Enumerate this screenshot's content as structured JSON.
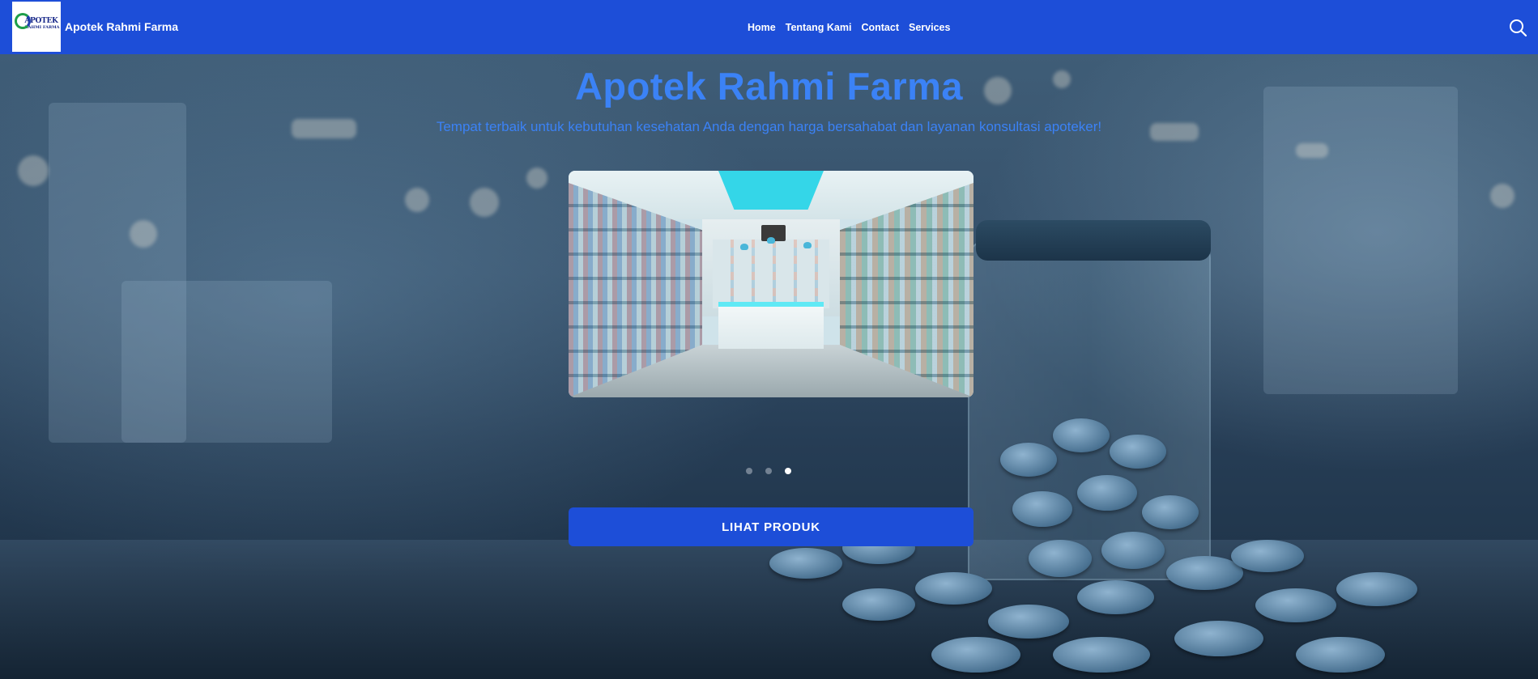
{
  "brand": {
    "name": "Apotek Rahmi Farma",
    "logo_line1": "APOTEK",
    "logo_line2": "RAHMI FARMA",
    "logo_line3": ""
  },
  "nav": {
    "items": [
      {
        "label": "Home"
      },
      {
        "label": "Tentang Kami"
      },
      {
        "label": "Contact"
      },
      {
        "label": "Services"
      }
    ],
    "search_icon": "search-icon"
  },
  "hero": {
    "title": "Apotek Rahmi Farma",
    "subtitle": "Tempat terbaik untuk kebutuhan kesehatan Anda dengan harga bersahabat dan layanan konsultasi apoteker!",
    "carousel": {
      "slide_count": 3,
      "active_index": 2
    },
    "cta_label": "LIHAT PRODUK"
  },
  "colors": {
    "navbar": "#1d4ed8",
    "title": "#3b82f6",
    "button": "#1d4ed8"
  }
}
